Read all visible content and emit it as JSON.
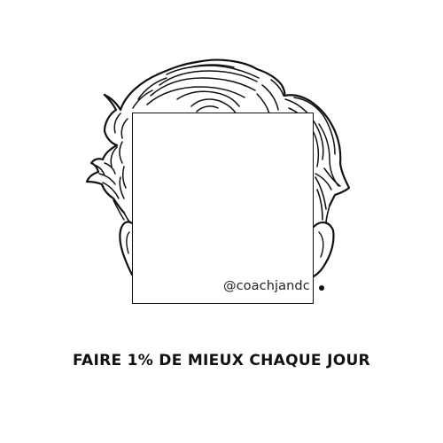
{
  "handle": "@coachjandc",
  "tagline": "FAIRE 1% DE MIEUX CHAQUE JOUR",
  "colors": {
    "ink": "#111111",
    "background": "#ffffff"
  },
  "icons": {
    "illustration": "hair-outline-icon",
    "marker": "dot-icon"
  }
}
